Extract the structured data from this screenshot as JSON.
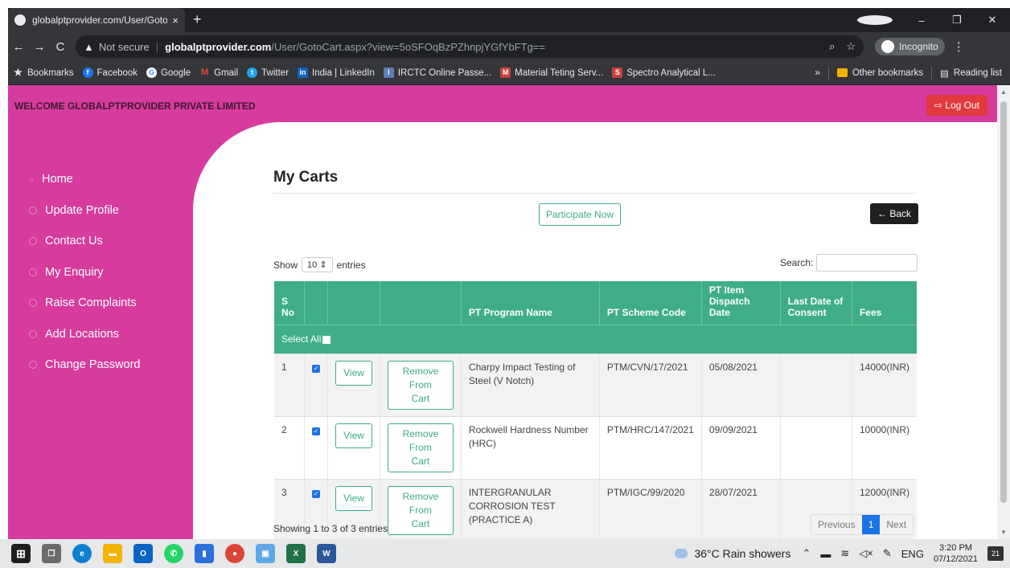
{
  "browser": {
    "tab_title": "globalptprovider.com/User/Goto",
    "tab_close": "×",
    "new_tab": "+",
    "nav": {
      "back": "←",
      "forward": "→",
      "reload": "C"
    },
    "security_label": "Not secure",
    "url_host": "globalptprovider.com",
    "url_path": "/User/GotoCart.aspx?view=5oSFOqBzPZhnpjYGfYbFTg==",
    "zoom_icon": "⌕",
    "star_icon": "☆",
    "profile_label": "Incognito",
    "menu": "⋮",
    "window_controls": {
      "minimize": "–",
      "restore": "❐",
      "close": "✕"
    }
  },
  "bookmarks": {
    "items": [
      {
        "label": "Bookmarks",
        "icon": "★",
        "color": "#202124"
      },
      {
        "label": "Facebook",
        "icon": "f",
        "color": "#1877f2"
      },
      {
        "label": "Google",
        "icon": "G",
        "color": "#4285f4"
      },
      {
        "label": "Gmail",
        "icon": "M",
        "color": "#ea4335"
      },
      {
        "label": "Twitter",
        "icon": "t",
        "color": "#1da1f2"
      },
      {
        "label": "India | LinkedIn",
        "icon": "in",
        "color": "#0a66c2"
      },
      {
        "label": "IRCTC Online Passe...",
        "icon": "I",
        "color": "#5b7fb8"
      },
      {
        "label": "Material Teting Serv...",
        "icon": "M",
        "color": "#c8413c"
      },
      {
        "label": "Spectro Analytical L...",
        "icon": "S",
        "color": "#c8413c"
      }
    ],
    "more": "»",
    "other": "Other bookmarks",
    "reading": "Reading list"
  },
  "header": {
    "welcome": "WELCOME GLOBALPTPROVIDER PRIVATE LIMITED",
    "logout": "Log Out",
    "logout_icon": "⇨"
  },
  "sidebar": {
    "items": [
      {
        "label": "Home",
        "icon": "home-icon"
      },
      {
        "label": "Update Profile",
        "icon": "circle-icon"
      },
      {
        "label": "Contact Us",
        "icon": "circle-icon"
      },
      {
        "label": "My Enquiry",
        "icon": "circle-icon"
      },
      {
        "label": "Raise Complaints",
        "icon": "circle-icon"
      },
      {
        "label": "Add Locations",
        "icon": "circle-icon"
      },
      {
        "label": "Change Password",
        "icon": "circle-icon"
      }
    ]
  },
  "main": {
    "title": "My Carts",
    "participate": "Participate Now",
    "back": "← Back",
    "show_label": "Show",
    "entries_value": "10",
    "entries_label": "entries",
    "search_label": "Search:",
    "select_all": "Select All",
    "columns": [
      "S No",
      "",
      "",
      "",
      "PT Program Name",
      "PT Scheme Code",
      "PT Item Dispatch Date",
      "Last Date of Consent",
      "Fees"
    ],
    "view_label": "View",
    "remove_label": "Remove From Cart",
    "rows": [
      {
        "sno": "1",
        "name": "Charpy Impact Testing of Steel (V Notch)",
        "code": "PTM/CVN/17/2021",
        "dispatch": "05/08/2021",
        "consent": "",
        "fees": "14000(INR)"
      },
      {
        "sno": "2",
        "name": "Rockwell Hardness Number (HRC)",
        "code": "PTM/HRC/147/2021",
        "dispatch": "09/09/2021",
        "consent": "",
        "fees": "10000(INR)"
      },
      {
        "sno": "3",
        "name": "INTERGRANULAR CORROSION TEST (PRACTICE A)",
        "code": "PTM/IGC/99/2020",
        "dispatch": "28/07/2021",
        "consent": "",
        "fees": "12000(INR)"
      }
    ],
    "showing": "Showing 1 to 3 of 3 entries",
    "pager": {
      "prev": "Previous",
      "current": "1",
      "next": "Next"
    }
  },
  "taskbar": {
    "weather": "36°C  Rain showers",
    "lang": "ENG",
    "time": "3:20 PM",
    "date": "07/12/2021",
    "notifications": "21",
    "apps": [
      {
        "name": "start",
        "color": "#1f1f1f",
        "glyph": "⊞"
      },
      {
        "name": "taskview",
        "color": "#555",
        "glyph": "❐"
      },
      {
        "name": "edge",
        "color": "#0f7fd0",
        "glyph": "e"
      },
      {
        "name": "explorer",
        "color": "#f3b400",
        "glyph": "▬"
      },
      {
        "name": "outlook",
        "color": "#0a64c4",
        "glyph": "O"
      },
      {
        "name": "whatsapp",
        "color": "#25d366",
        "glyph": "✆"
      },
      {
        "name": "phone",
        "color": "#2a6fdb",
        "glyph": "▮"
      },
      {
        "name": "chrome",
        "color": "#db4437",
        "glyph": "●"
      },
      {
        "name": "photos",
        "color": "#5fa8e6",
        "glyph": "▣"
      },
      {
        "name": "excel",
        "color": "#1e7145",
        "glyph": "X"
      },
      {
        "name": "word",
        "color": "#2b579a",
        "glyph": "W"
      }
    ]
  }
}
